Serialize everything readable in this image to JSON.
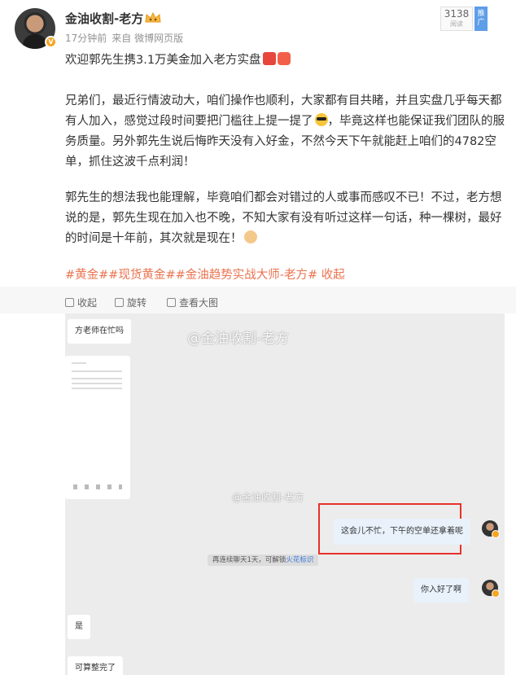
{
  "post": {
    "username": "金油收割-老方",
    "time": "17分钟前",
    "source": "来自 微博网页版",
    "reads_count": "3138",
    "reads_label": "阅读",
    "promote_label": "推广",
    "headline": "欢迎郭先生携3.1万美金加入老方实盘",
    "para1": "兄弟们，最近行情波动大，咱们操作也顺利，大家都有目共睹，并且实盘几乎每天都有人加入，感觉过段时间要把门槛往上提一提了",
    "para1_tail": "，毕竟这样也能保证我们团队的服务质量。另外郭先生说后悔昨天没有入好金，不然今天下午就能赶上咱们的4782空单，抓住这波千点利润！",
    "para2": "郭先生的想法我也能理解，毕竟咱们都会对错过的人或事而感叹不已！不过，老方想说的是，郭先生现在加入也不晚，不知大家有没有听过这样一句话，种一棵树，最好的时间是十年前，其次就是现在！",
    "tags": "#黄金##现货黄金##金油趋势实战大师-老方#",
    "collapse": " 收起"
  },
  "media_toolbar": {
    "collapse": "收起",
    "rotate": "旋转",
    "view_large": "查看大图"
  },
  "chat": {
    "watermark_main": "@金油收割-老方",
    "watermark_small": "@金油收割-老方",
    "msg_left_1": "方老师在忙吗",
    "msg_right_1": "这会儿不忙，下午的空单还拿着呢",
    "notice": "再连续聊天1天，可解锁",
    "notice_link": "火花标识",
    "msg_right_2": "你入好了啊",
    "msg_left_2": "是",
    "msg_left_3": "可算整完了"
  },
  "colors": {
    "tag": "#eb7350",
    "highlight_box": "#e8312a",
    "promote": "#5d9ee8"
  }
}
